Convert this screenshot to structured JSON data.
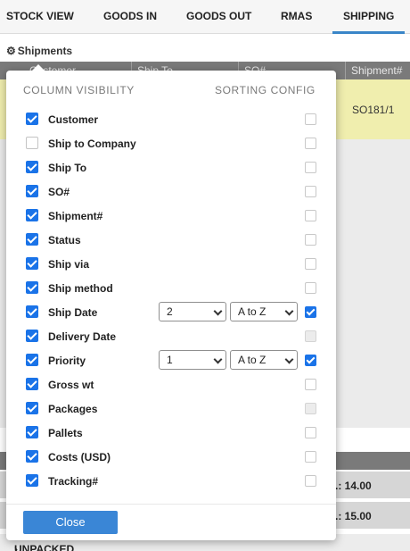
{
  "tabs": [
    {
      "label": "STOCK VIEW",
      "active": false
    },
    {
      "label": "GOODS IN",
      "active": false
    },
    {
      "label": "GOODS OUT",
      "active": false
    },
    {
      "label": "RMAS",
      "active": false
    },
    {
      "label": "SHIPPING",
      "active": true
    }
  ],
  "section": {
    "title": "Shipments",
    "icon": "gear-icon"
  },
  "table": {
    "columns": [
      "Customer",
      "Ship To",
      "SO#",
      "Shipment#"
    ],
    "highlight_row_value": "SO181/1",
    "summary_rows": [
      ".: 14.00",
      ".: 15.00"
    ],
    "unpacked_label": "UNPACKED"
  },
  "modal": {
    "visibility_heading": "COLUMN VISIBILITY",
    "sorting_heading": "SORTING CONFIG",
    "items": [
      {
        "label": "Customer",
        "visible": true,
        "sort": false,
        "sort_disabled": false
      },
      {
        "label": "Ship to Company",
        "visible": false,
        "sort": false,
        "sort_disabled": false
      },
      {
        "label": "Ship To",
        "visible": true,
        "sort": false,
        "sort_disabled": false
      },
      {
        "label": "SO#",
        "visible": true,
        "sort": false,
        "sort_disabled": false
      },
      {
        "label": "Shipment#",
        "visible": true,
        "sort": false,
        "sort_disabled": false
      },
      {
        "label": "Status",
        "visible": true,
        "sort": false,
        "sort_disabled": false
      },
      {
        "label": "Ship via",
        "visible": true,
        "sort": false,
        "sort_disabled": false
      },
      {
        "label": "Ship method",
        "visible": true,
        "sort": false,
        "sort_disabled": false
      },
      {
        "label": "Ship Date",
        "visible": true,
        "sort": true,
        "sort_disabled": false,
        "priority": "2",
        "order": "A to Z"
      },
      {
        "label": "Delivery Date",
        "visible": true,
        "sort": false,
        "sort_disabled": true
      },
      {
        "label": "Priority",
        "visible": true,
        "sort": true,
        "sort_disabled": false,
        "priority": "1",
        "order": "A to Z"
      },
      {
        "label": "Gross wt",
        "visible": true,
        "sort": false,
        "sort_disabled": false
      },
      {
        "label": "Packages",
        "visible": true,
        "sort": false,
        "sort_disabled": true
      },
      {
        "label": "Pallets",
        "visible": true,
        "sort": false,
        "sort_disabled": false
      },
      {
        "label": "Costs (USD)",
        "visible": true,
        "sort": false,
        "sort_disabled": false
      },
      {
        "label": "Tracking#",
        "visible": true,
        "sort": false,
        "sort_disabled": false
      }
    ],
    "close_label": "Close"
  },
  "colors": {
    "accent": "#1a73e8",
    "button": "#3a86d6",
    "highlight_row": "#f0eeae",
    "header_bar": "#7a7a7a"
  }
}
